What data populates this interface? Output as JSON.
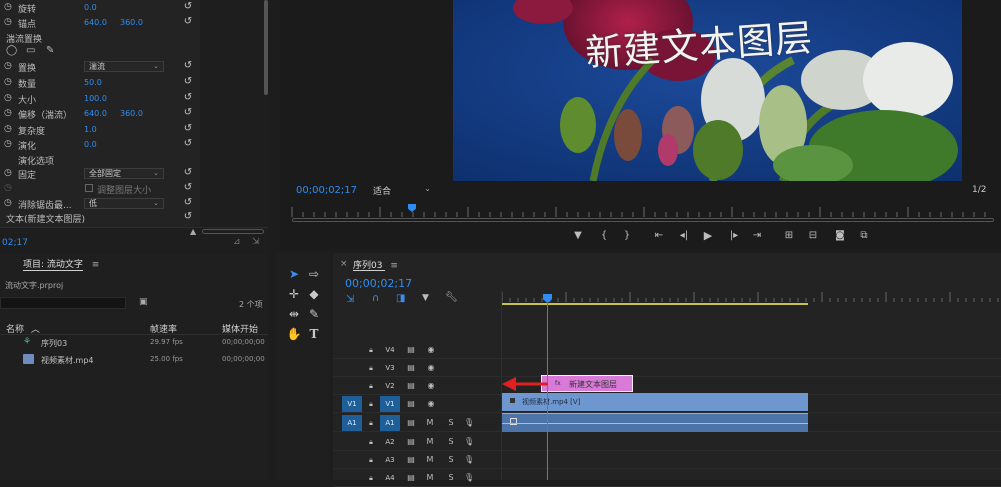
{
  "effects": {
    "rows": [
      {
        "label": "旋转",
        "v1": "0.0"
      },
      {
        "label": "锚点",
        "v1": "640.0",
        "v2": "360.0"
      },
      {
        "label": "湍流置换"
      },
      {
        "label": "置换",
        "select": "湍流"
      },
      {
        "label": "数量",
        "v1": "50.0"
      },
      {
        "label": "大小",
        "v1": "100.0"
      },
      {
        "label": "偏移（湍流）",
        "v1": "640.0",
        "v2": "360.0"
      },
      {
        "label": "复杂度",
        "v1": "1.0"
      },
      {
        "label": "演化",
        "v1": "0.0"
      },
      {
        "label": "演化选项"
      },
      {
        "label": "固定",
        "select": "全部固定"
      },
      {
        "label": "调整图层大小"
      },
      {
        "label": "消除锯齿最...",
        "select": "低"
      },
      {
        "label": "文本(新建文本图层)"
      }
    ],
    "timecode": "02;17"
  },
  "program": {
    "overlay_text": "新建文本图层",
    "timecode": "00;00;02;17",
    "fit": "适合",
    "resolution": "1/2"
  },
  "project": {
    "tab": "项目: 流动文字",
    "file": "流动文字.prproj",
    "count": "2 个项",
    "col_name": "名称",
    "col_fps": "帧速率",
    "col_start": "媒体开始",
    "items": [
      {
        "name": "序列03",
        "fps": "29.97 fps",
        "start": "00;00;00;00"
      },
      {
        "name": "视频素材.mp4",
        "fps": "25.00 fps",
        "start": "00;00;00;00"
      }
    ]
  },
  "timeline": {
    "tab": "序列03",
    "timecode": "00;00;02;17",
    "tracks": [
      {
        "src": "",
        "name": "V4",
        "kind": "video"
      },
      {
        "src": "",
        "name": "V3",
        "kind": "video"
      },
      {
        "src": "",
        "name": "V2",
        "kind": "video"
      },
      {
        "src": "V1",
        "name": "V1",
        "kind": "video"
      },
      {
        "src": "A1",
        "name": "A1",
        "kind": "audio"
      },
      {
        "src": "",
        "name": "A2",
        "kind": "audio"
      },
      {
        "src": "",
        "name": "A3",
        "kind": "audio"
      },
      {
        "src": "",
        "name": "A4",
        "kind": "audio"
      }
    ],
    "clip_text": "新建文本图层",
    "clip_video": "视频素材.mp4 [V]",
    "mute": "M",
    "solo": "S"
  },
  "colors": {
    "accent": "#2f8df2",
    "text_clip": "#d97ad9",
    "video_clip": "#6f97cf",
    "arrow": "#e02020"
  }
}
